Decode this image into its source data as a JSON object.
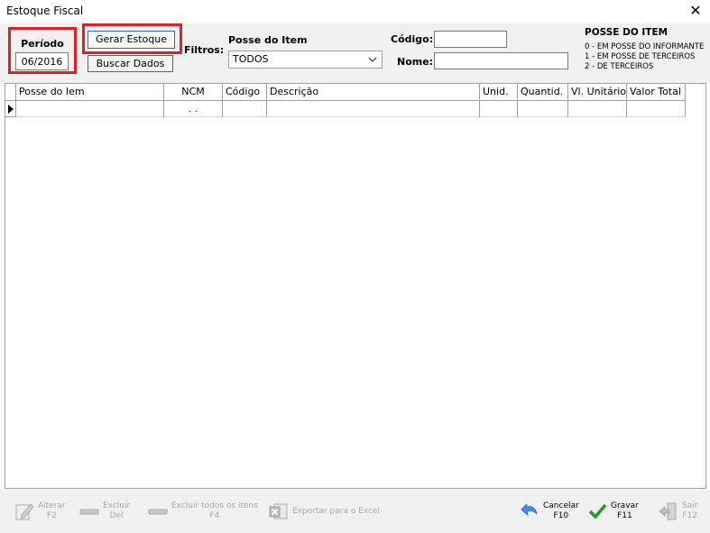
{
  "window": {
    "title": "Estoque Fiscal",
    "close_glyph": "✕"
  },
  "periodo": {
    "label": "Período",
    "value": "06/2016"
  },
  "buttons": {
    "gerar": "Gerar Estoque",
    "buscar": "Buscar Dados"
  },
  "filtros": {
    "label": "Filtros:",
    "posse_label": "Posse do Item",
    "posse_selected": "TODOS",
    "codigo_label": "Código:",
    "codigo_value": "",
    "nome_label": "Nome:",
    "nome_value": ""
  },
  "legend": {
    "title": "POSSE DO ITEM",
    "lines": [
      "0 - EM POSSE DO INFORMANTE",
      "1 - EM POSSE DE TERCEIROS",
      "2 - DE TERCEIROS"
    ]
  },
  "grid": {
    "columns": [
      "Posse do Iem",
      "NCM",
      "Código",
      "Descrição",
      "Unid.",
      "Quantid.",
      "Vl. Unitário",
      "Valor Total"
    ],
    "rows": [
      [
        "",
        ". .",
        "",
        "",
        "",
        "",
        "",
        ""
      ]
    ]
  },
  "toolbar": {
    "alterar": {
      "line1": "Alterar",
      "line2": "F2"
    },
    "excluir": {
      "line1": "Excluir",
      "line2": "Del"
    },
    "excluir_todos": {
      "line1": "Excluir todos os itens",
      "line2": "F4"
    },
    "exportar": {
      "line1": "Exportar para o Excel"
    },
    "cancelar": {
      "line1": "Cancelar",
      "line2": "F10"
    },
    "gravar": {
      "line1": "Gravar",
      "line2": "F11"
    },
    "sair": {
      "line1": "Sair",
      "line2": "F12"
    }
  },
  "colors": {
    "highlight_red": "#e01e2d",
    "button_border": "#2f6db5",
    "panel_bg": "#f0f0f0",
    "check_green": "#1f9a2e",
    "undo_blue": "#2a6fc0"
  }
}
